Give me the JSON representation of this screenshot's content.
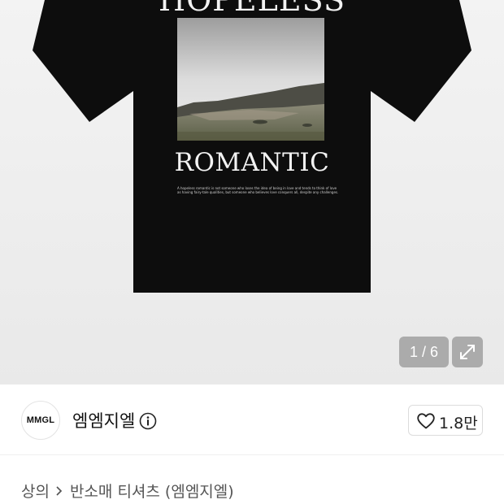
{
  "product_image": {
    "shirt_print_top": "HOPELESS",
    "shirt_print_bottom": "ROMANTIC",
    "shirt_fine_print": "A hopeless romantic is not someone who loses the idea of being in love and tends to think of love as having fairy-tale qualities, but someone who believes love conquers all, despite any challenges.",
    "counter": "1 / 6",
    "expand_icon": "expand-icon"
  },
  "brand": {
    "logo_text": "MMGL",
    "name": "엠엠지엘",
    "info_icon": "info-icon"
  },
  "like": {
    "icon": "heart-icon",
    "count": "1.8만"
  },
  "breadcrumb": {
    "category": "상의",
    "subcategory": "반소매 티셔츠 (엠엠지엘)"
  },
  "colors": {
    "shirt": "#0d0d0d",
    "page_bg": "#f0f0f0",
    "overlay": "#969696"
  }
}
